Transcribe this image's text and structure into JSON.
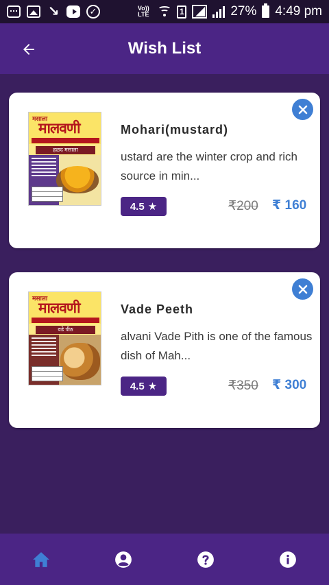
{
  "status_bar": {
    "volte": "Vo)) LTE",
    "sim_slot": "1",
    "battery": "27%",
    "time": "4:49 pm",
    "icons": [
      "message-icon",
      "gallery-icon",
      "missed-call-icon",
      "youtube-icon",
      "check-circle-icon",
      "wifi-icon",
      "signal-icon",
      "battery-icon"
    ]
  },
  "header": {
    "title": "Wish List",
    "back_icon": "arrow-left-icon"
  },
  "wishlist": [
    {
      "name": "Mohari(mustard)",
      "description": "ustard are the winter crop and rich source in min...",
      "rating": "4.5",
      "old_price": "₹200",
      "new_price": "₹ 160",
      "thumb": {
        "brand_small": "मसाला",
        "brand": "मालवणी",
        "label": "हळद मसाला"
      }
    },
    {
      "name": "Vade Peeth",
      "description": "alvani Vade Pith is one of the famous dish of Mah...",
      "rating": "4.5",
      "old_price": "₹350",
      "new_price": "₹ 300",
      "thumb": {
        "brand_small": "मसाला",
        "brand": "मालवणी",
        "label": "वडे पीठ"
      }
    }
  ],
  "bottom_nav": [
    {
      "icon": "home-icon",
      "color": "#3f7fd4",
      "active": true
    },
    {
      "icon": "account-icon",
      "color": "#ffffff",
      "active": false
    },
    {
      "icon": "help-icon",
      "color": "#ffffff",
      "active": false
    },
    {
      "icon": "info-icon",
      "color": "#ffffff",
      "active": false
    }
  ],
  "colors": {
    "primary": "#4b2585",
    "background": "#3a1f5e",
    "accent": "#3f7fd4"
  }
}
